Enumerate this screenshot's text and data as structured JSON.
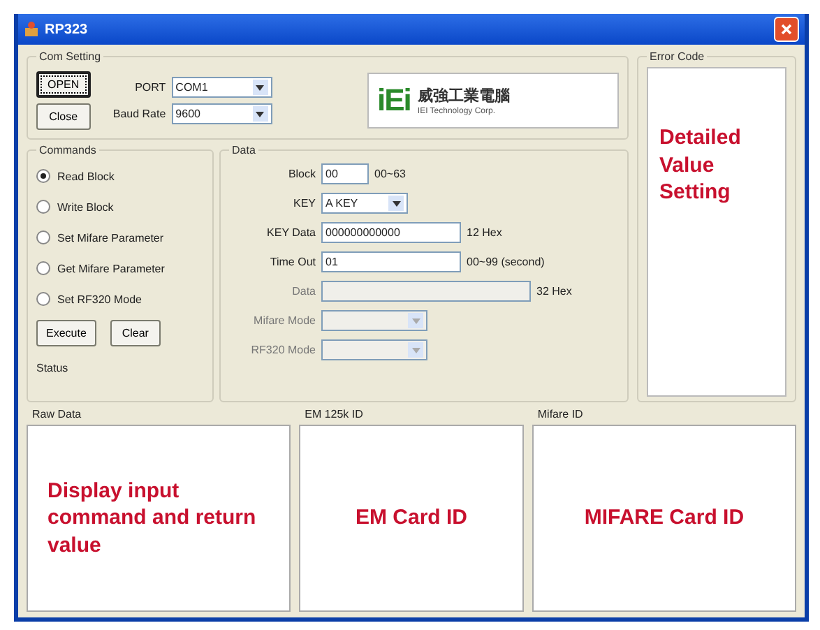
{
  "window": {
    "title": "RP323"
  },
  "com_setting": {
    "title": "Com Setting",
    "buttons": [
      {
        "label": "OPEN",
        "focused": true
      },
      {
        "label": "Close",
        "focused": false
      }
    ],
    "fields": [
      {
        "label": "PORT",
        "value": "COM1"
      },
      {
        "label": "Baud Rate",
        "value": "9600"
      }
    ]
  },
  "logo": {
    "mark": "iEi",
    "name": "威強工業電腦",
    "subtitle": "IEI Technology Corp."
  },
  "error_code": {
    "title": "Error Code",
    "note": "Detailed Value Setting"
  },
  "commands": {
    "title": "Commands",
    "options": [
      {
        "label": "Read Block",
        "selected": true
      },
      {
        "label": "Write Block",
        "selected": false
      },
      {
        "label": "Set Mifare Parameter",
        "selected": false
      },
      {
        "label": "Get Mifare Parameter",
        "selected": false
      },
      {
        "label": "Set RF320 Mode",
        "selected": false
      }
    ],
    "buttons": [
      "Execute",
      "Clear"
    ],
    "status_label": "Status"
  },
  "data": {
    "title": "Data",
    "fields": [
      {
        "kind": "input",
        "label": "Block",
        "value": "00",
        "hint": "00~63",
        "disabled": false
      },
      {
        "kind": "select",
        "label": "KEY",
        "value": "A KEY",
        "disabled": false
      },
      {
        "kind": "input",
        "label": "KEY Data",
        "value": "000000000000",
        "hint": "12 Hex",
        "disabled": false
      },
      {
        "kind": "input",
        "label": "Time Out",
        "value": "01",
        "hint": "00~99 (second)",
        "disabled": false
      },
      {
        "kind": "input",
        "label": "Data",
        "hint": "32 Hex",
        "disabled": true
      },
      {
        "kind": "select",
        "label": "Mifare Mode",
        "disabled": true
      },
      {
        "kind": "select",
        "label": "RF320 Mode",
        "disabled": true
      }
    ]
  },
  "panels": [
    {
      "title": "Raw Data",
      "note": "Display input command and return value"
    },
    {
      "title": "EM 125k ID",
      "note": "EM Card ID"
    },
    {
      "title": "Mifare ID",
      "note": "MIFARE Card ID"
    }
  ]
}
